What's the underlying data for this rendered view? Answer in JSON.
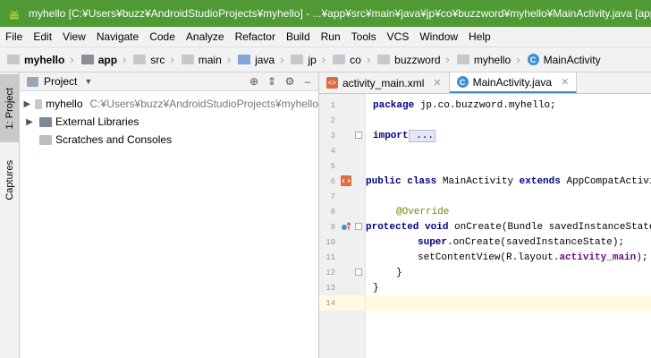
{
  "window": {
    "title": "myhello [C:¥Users¥buzz¥AndroidStudioProjects¥myhello] - ...¥app¥src¥main¥java¥jp¥co¥buzzword¥myhello¥MainActivity.java [app] - A"
  },
  "menu": [
    "File",
    "Edit",
    "View",
    "Navigate",
    "Code",
    "Analyze",
    "Refactor",
    "Build",
    "Run",
    "Tools",
    "VCS",
    "Window",
    "Help"
  ],
  "breadcrumbs": [
    "myhello",
    "app",
    "src",
    "main",
    "java",
    "jp",
    "co",
    "buzzword",
    "myhello",
    "MainActivity"
  ],
  "side_tabs": {
    "project": "1: Project",
    "captures": "Captures"
  },
  "project_panel": {
    "title": "Project",
    "tree": [
      {
        "label": "myhello",
        "path": "C:¥Users¥buzz¥AndroidStudioProjects¥myhello"
      },
      {
        "label": "External Libraries",
        "path": ""
      },
      {
        "label": "Scratches and Consoles",
        "path": ""
      }
    ]
  },
  "editor": {
    "tabs": [
      {
        "label": "activity_main.xml",
        "active": false
      },
      {
        "label": "MainActivity.java",
        "active": true
      }
    ],
    "line_numbers": [
      "1",
      "2",
      "3",
      "4",
      "5",
      "6",
      "7",
      "8",
      "9",
      "10",
      "11",
      "12",
      "13",
      "14"
    ],
    "code": {
      "l1_kw": "package",
      "l1_rest": " jp.co.buzzword.myhello;",
      "l3_kw": "import",
      "l3_rest": " ...",
      "l6_kw1": "public",
      "l6_kw2": "class",
      "l6_name": " MainActivity ",
      "l6_kw3": "extends",
      "l6_rest": " AppCompatActivity {",
      "l8_ann": "@Override",
      "l9_kw1": "protected",
      "l9_kw2": "void",
      "l9_rest": " onCreate(Bundle savedInstanceState) {",
      "l10_kw": "super",
      "l10_rest": ".onCreate(savedInstanceState);",
      "l11_a": "setContentView(R.layout.",
      "l11_b": "activity_main",
      "l11_c": ");",
      "l12": "}",
      "l13": "}"
    }
  }
}
